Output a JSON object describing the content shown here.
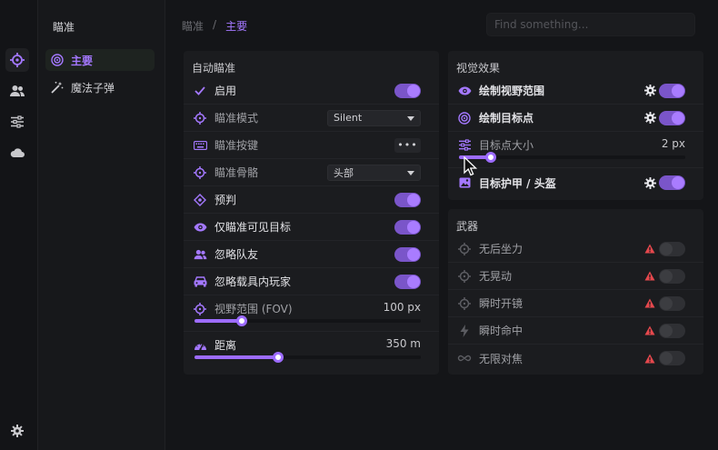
{
  "search": {
    "placeholder": "Find something..."
  },
  "breadcrumb": {
    "parent": "瞄准",
    "separator": "/",
    "current": "主要"
  },
  "subnav": {
    "title": "瞄准",
    "items": [
      {
        "label": "主要",
        "icon": "target-icon",
        "active": true
      },
      {
        "label": "魔法子弹",
        "icon": "magic-wand-icon",
        "active": false
      }
    ]
  },
  "rail": {
    "items": [
      "crosshair-icon",
      "users-icon",
      "sliders-icon",
      "cloud-icon"
    ],
    "bottom": "gear-icon"
  },
  "aimbot": {
    "title": "自动瞄准",
    "enable_label": "启用",
    "mode_label": "瞄准模式",
    "mode_value": "Silent",
    "key_label": "瞄准按键",
    "key_value": "•••",
    "bone_label": "瞄准骨骼",
    "bone_value": "头部",
    "predict_label": "预判",
    "visible_only_label": "仅瞄准可见目标",
    "ignore_team_label": "忽略队友",
    "ignore_vehicle_label": "忽略载具内玩家",
    "fov_label": "视野范围 (FOV)",
    "fov_value": "100 px",
    "fov_fraction": 0.21,
    "distance_label": "距离",
    "distance_value": "350 m",
    "distance_fraction": 0.37
  },
  "visuals": {
    "title": "视觉效果",
    "draw_fov_label": "绘制视野范围",
    "draw_target_label": "绘制目标点",
    "target_size_label": "目标点大小",
    "target_size_value": "2 px",
    "target_size_fraction": 0.14,
    "armor_label": "目标护甲 / 头盔"
  },
  "weapons": {
    "title": "武器",
    "items": [
      {
        "label": "无后坐力",
        "icon": "crosshair-icon",
        "on": false
      },
      {
        "label": "无晃动",
        "icon": "crosshair-icon",
        "on": false
      },
      {
        "label": "瞬时开镜",
        "icon": "crosshair-icon",
        "on": false
      },
      {
        "label": "瞬时命中",
        "icon": "bolt-icon",
        "on": false
      },
      {
        "label": "无限对焦",
        "icon": "infinity-icon",
        "on": false
      }
    ]
  },
  "colors": {
    "accent": "#9d6cff",
    "warning": "#e5484d",
    "background": "#141518",
    "panel": "#1b1c1f"
  }
}
